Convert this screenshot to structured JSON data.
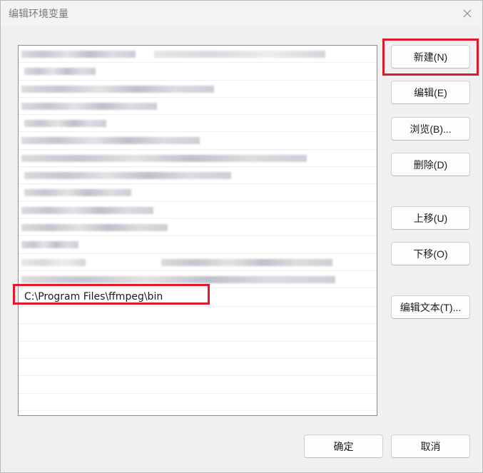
{
  "window": {
    "title": "编辑环境变量"
  },
  "list": {
    "selected_path": "C:\\Program Files\\ffmpeg\\bin"
  },
  "buttons": {
    "new": "新建(N)",
    "edit": "编辑(E)",
    "browse": "浏览(B)...",
    "delete": "删除(D)",
    "move_up": "上移(U)",
    "move_down": "下移(O)",
    "edit_text": "编辑文本(T)...",
    "ok": "确定",
    "cancel": "取消"
  }
}
